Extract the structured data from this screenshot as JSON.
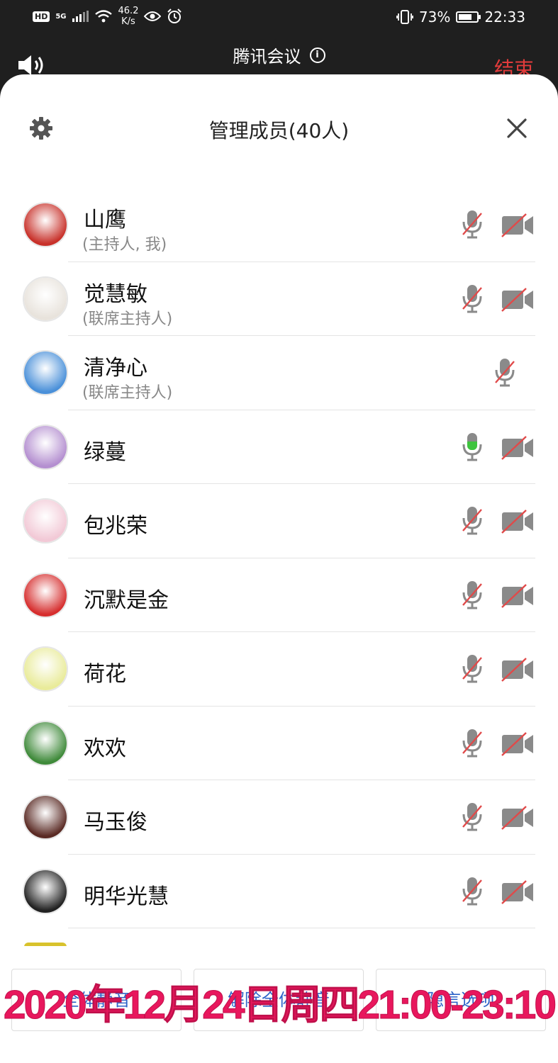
{
  "status_bar": {
    "hd": "HD",
    "network": "5G",
    "speed_value": "46.2",
    "speed_unit": "K/s",
    "battery": "73%",
    "battery_level": 0.73,
    "time": "22:33"
  },
  "top_bar": {
    "title": "腾讯会议",
    "end_label": "结束"
  },
  "sheet": {
    "title": "管理成员(40人)"
  },
  "members": [
    {
      "name": "山鹰",
      "role": "(主持人, 我)",
      "mic": "muted",
      "camera": "off",
      "avatar_color": "#c8312a"
    },
    {
      "name": "觉慧敏",
      "role": "(联席主持人)",
      "mic": "muted",
      "camera": "off",
      "avatar_color": "#e8e3dc"
    },
    {
      "name": "清净心",
      "role": "(联席主持人)",
      "mic": "muted",
      "camera": "none",
      "avatar_color": "#4a90d9"
    },
    {
      "name": "绿蔓",
      "role": "",
      "mic": "active",
      "camera": "off",
      "avatar_color": "#b48fd0"
    },
    {
      "name": "包兆荣",
      "role": "",
      "mic": "muted",
      "camera": "off",
      "avatar_color": "#f2c9d6"
    },
    {
      "name": "沉默是金",
      "role": "",
      "mic": "muted",
      "camera": "off",
      "avatar_color": "#d62e2e"
    },
    {
      "name": "荷花",
      "role": "",
      "mic": "muted",
      "camera": "off",
      "avatar_color": "#e9eb9a"
    },
    {
      "name": "欢欢",
      "role": "",
      "mic": "muted",
      "camera": "off",
      "avatar_color": "#3f8a3a"
    },
    {
      "name": "马玉俊",
      "role": "",
      "mic": "muted",
      "camera": "off",
      "avatar_color": "#5a2a24"
    },
    {
      "name": "明华光慧",
      "role": "",
      "mic": "muted",
      "camera": "off",
      "avatar_color": "#222222"
    }
  ],
  "footer": {
    "mute_all": "全体静音",
    "unmute_all": "解除全体静音",
    "more": "隐言选项"
  },
  "watermark": "2020年12月24日周四21:00-23:10",
  "colors": {
    "accent_blue": "#2d64c8",
    "end_red": "#e23b3b",
    "watermark_pink": "#e8175d",
    "mic_active_green": "#3ec43e",
    "muted_slash_red": "#e04a4a",
    "icon_gray": "#8a8a8a"
  }
}
